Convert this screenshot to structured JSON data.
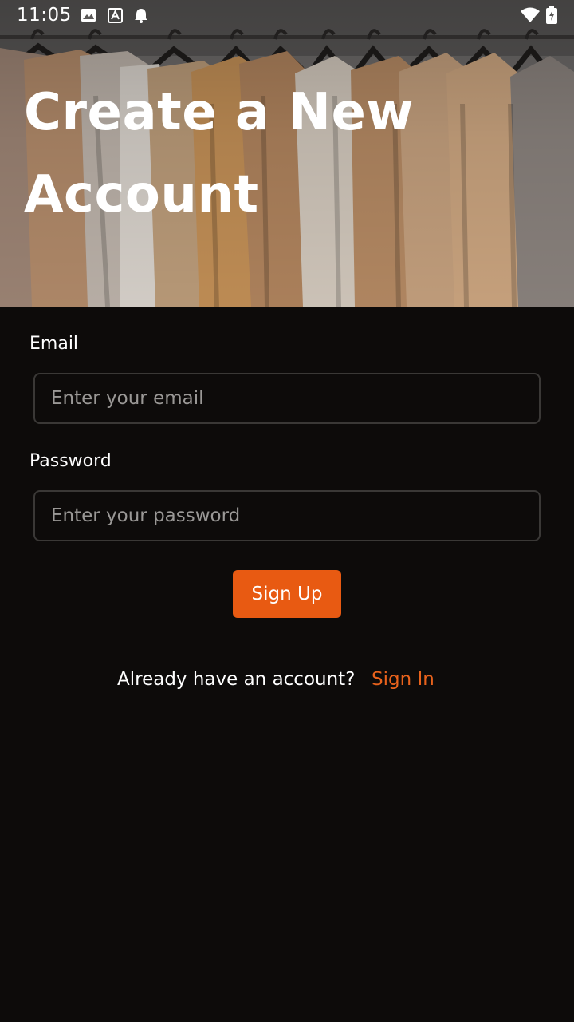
{
  "status_bar": {
    "time": "11:05",
    "left_icons": [
      "image-icon",
      "text-a-icon",
      "bell-icon"
    ],
    "right_icons": [
      "wifi-icon",
      "battery-charging-icon"
    ]
  },
  "hero": {
    "image": "clothing-rack-photo",
    "title_line1": "Create a New",
    "title_line2": "Account"
  },
  "form": {
    "email_label": "Email",
    "email_placeholder": "Enter your email",
    "email_value": "",
    "password_label": "Password",
    "password_placeholder": "Enter your password",
    "password_value": "",
    "submit_label": "Sign Up"
  },
  "footer": {
    "prompt": "Already have an account?",
    "link_label": "Sign In"
  },
  "colors": {
    "background": "#0d0b0a",
    "accent": "#e85a12",
    "link": "#e8621c",
    "field_border": "#3a3836",
    "text": "#ffffff",
    "placeholder": "#9a9896"
  }
}
